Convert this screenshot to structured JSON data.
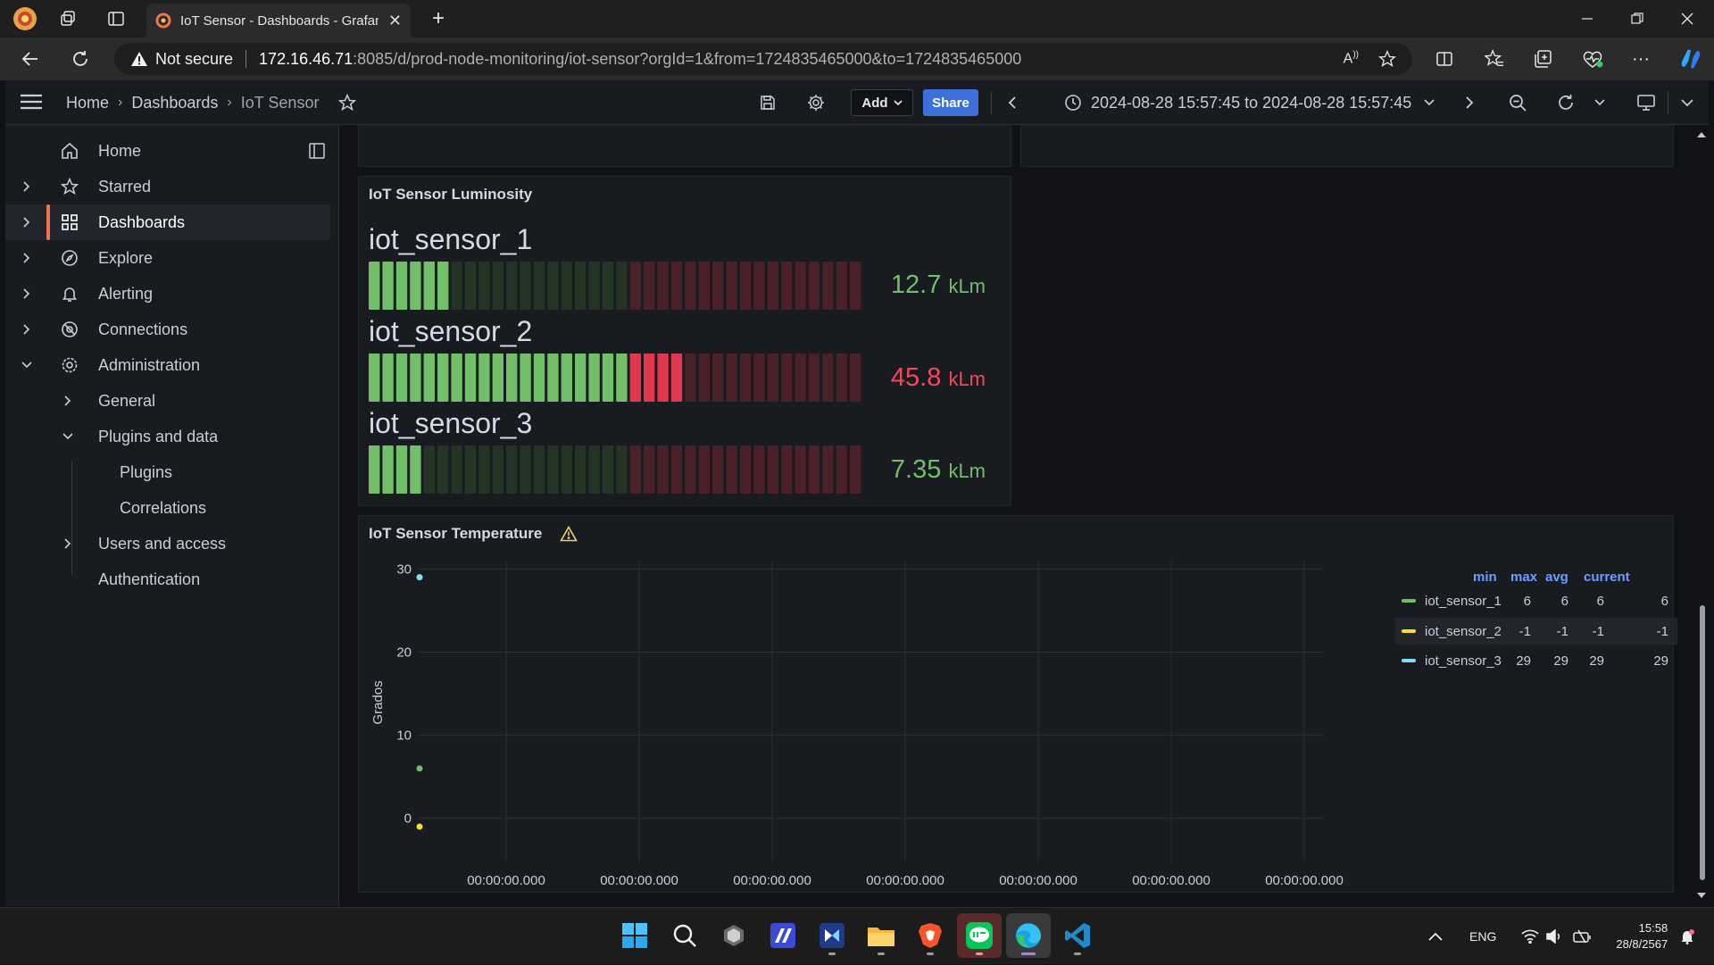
{
  "browser": {
    "tab_title": "IoT Sensor - Dashboards - Grafana",
    "security_label": "Not secure",
    "url_host": "172.16.46.71",
    "url_rest": ":8085/d/prod-node-monitoring/iot-sensor?orgId=1&from=1724835465000&to=1724835465000"
  },
  "header": {
    "breadcrumbs": [
      "Home",
      "Dashboards",
      "IoT Sensor"
    ],
    "add_label": "Add",
    "share_label": "Share",
    "time_range": "2024-08-28 15:57:45 to 2024-08-28 15:57:45"
  },
  "sidebar": {
    "items": [
      {
        "label": "Home",
        "icon": "home-icon"
      },
      {
        "label": "Starred",
        "icon": "star-icon"
      },
      {
        "label": "Dashboards",
        "icon": "apps-icon",
        "active": true
      },
      {
        "label": "Explore",
        "icon": "compass-icon"
      },
      {
        "label": "Alerting",
        "icon": "bell-icon"
      },
      {
        "label": "Connections",
        "icon": "connections-icon"
      },
      {
        "label": "Administration",
        "icon": "cog-icon"
      },
      {
        "label": "General"
      },
      {
        "label": "Plugins and data"
      },
      {
        "label": "Plugins"
      },
      {
        "label": "Correlations"
      },
      {
        "label": "Users and access"
      },
      {
        "label": "Authentication"
      }
    ]
  },
  "luminosity_panel": {
    "title": "IoT Sensor Luminosity",
    "unit": "kLm",
    "sensors": [
      {
        "name": "iot_sensor_1",
        "value": "12.7",
        "fill": 0.18,
        "color": "#73bf69"
      },
      {
        "name": "iot_sensor_2",
        "value": "45.8",
        "fill": 0.65,
        "color": "#f2495c"
      },
      {
        "name": "iot_sensor_3",
        "value": "7.35",
        "fill": 0.1,
        "color": "#73bf69"
      }
    ]
  },
  "temperature_panel": {
    "title": "IoT Sensor Temperature",
    "legend_headers": [
      "min",
      "max",
      "avg",
      "current"
    ],
    "legend": [
      {
        "name": "iot_sensor_1",
        "color": "#73bf69",
        "min": "6",
        "max": "6",
        "avg": "6",
        "current": "6"
      },
      {
        "name": "iot_sensor_2",
        "color": "#fade2a",
        "min": "-1",
        "max": "-1",
        "avg": "-1",
        "current": "-1"
      },
      {
        "name": "iot_sensor_3",
        "color": "#5794f2",
        "min": "29",
        "max": "29",
        "avg": "29",
        "current": "29"
      }
    ],
    "chart_data": {
      "type": "scatter",
      "ylabel": "Grados",
      "xlabel": "",
      "ylim": [
        -1,
        31
      ],
      "y_ticks": [
        "30",
        "20",
        "10",
        "0"
      ],
      "x_ticks": [
        "00:00:00.000",
        "00:00:00.000",
        "00:00:00.000",
        "00:00:00.000",
        "00:00:00.000",
        "00:00:00.000",
        "00:00:00.000"
      ],
      "series": [
        {
          "name": "iot_sensor_1",
          "color": "#73bf69",
          "values": [
            6
          ]
        },
        {
          "name": "iot_sensor_2",
          "color": "#fade2a",
          "values": [
            -1
          ]
        },
        {
          "name": "iot_sensor_3",
          "color": "#5794f2",
          "values": [
            29
          ]
        }
      ]
    }
  },
  "taskbar": {
    "language": "ENG",
    "time": "15:58",
    "date": "28/8/2567"
  }
}
